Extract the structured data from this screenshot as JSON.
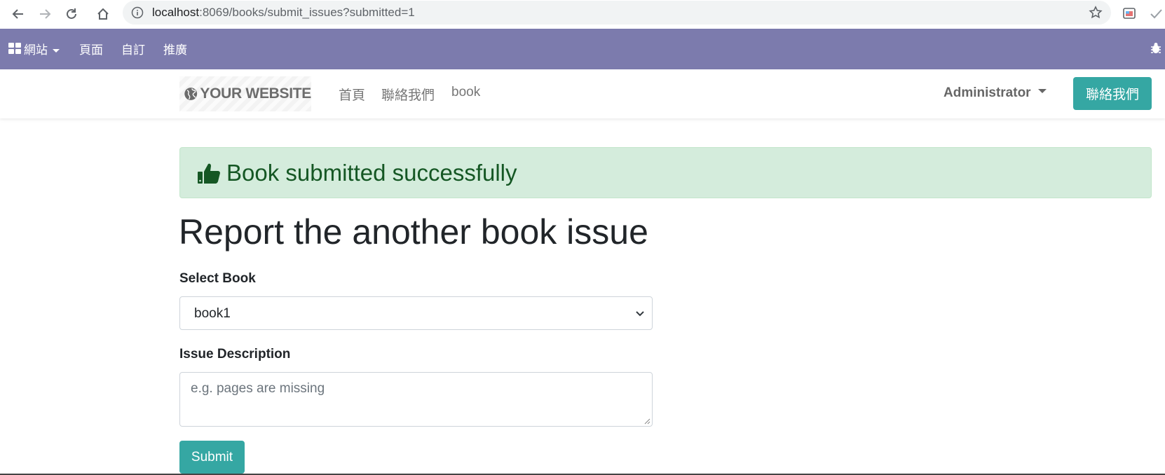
{
  "browser": {
    "url_host": "localhost",
    "url_path": ":8069/books/submit_issues?submitted=1"
  },
  "admin_bar": {
    "items": [
      {
        "label": "網站"
      },
      {
        "label": "頁面"
      },
      {
        "label": "自訂"
      },
      {
        "label": "推廣"
      }
    ]
  },
  "navbar": {
    "logo_text": "YOUR WEBSITE",
    "menu": [
      {
        "label": "首頁"
      },
      {
        "label": "聯絡我們"
      },
      {
        "label": "book"
      }
    ],
    "user": "Administrator",
    "cta": "聯絡我們"
  },
  "alert": {
    "text": "Book submitted successfully"
  },
  "page": {
    "title": "Report the another book issue"
  },
  "form": {
    "select_label": "Select Book",
    "selected_book": "book1",
    "description_label": "Issue Description",
    "description_placeholder": "e.g. pages are missing",
    "submit": "Submit"
  },
  "colors": {
    "admin_bar": "#7c7bad",
    "primary": "#35a7a3",
    "alert_bg": "#d4ecdc",
    "alert_text": "#155724"
  }
}
